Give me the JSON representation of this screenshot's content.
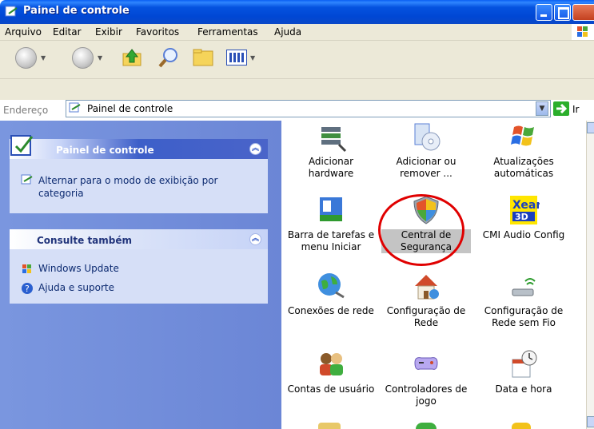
{
  "window": {
    "title": "Painel de controle",
    "icon": "control-panel-icon"
  },
  "menu": [
    "Arquivo",
    "Editar",
    "Exibir",
    "Favoritos",
    "Ferramentas",
    "Ajuda"
  ],
  "toolbar": {
    "back_icon": "back-arrow-icon",
    "forward_icon": "forward-arrow-icon",
    "up_icon": "folder-up-icon",
    "search_icon": "search-icon",
    "folders_icon": "folders-icon",
    "views_icon": "views-icon"
  },
  "address": {
    "label": "Endereço",
    "value": "Painel de controle",
    "go_label": "Ir"
  },
  "left": {
    "panel1": {
      "title": "Painel de controle",
      "link": "Alternar para o modo de exibição por categoria"
    },
    "panel2": {
      "title": "Consulte também",
      "links": [
        "Windows Update",
        "Ajuda e suporte"
      ]
    }
  },
  "items": [
    {
      "label": "Adicionar hardware",
      "icon": "add-hardware-icon"
    },
    {
      "label": "Adicionar ou remover ...",
      "icon": "add-remove-programs-icon"
    },
    {
      "label": "Atualizações automáticas",
      "icon": "automatic-updates-icon"
    },
    {
      "label": "Barra de tarefas e menu Iniciar",
      "icon": "taskbar-start-menu-icon"
    },
    {
      "label": "Central de Segurança",
      "icon": "security-center-icon",
      "selected": true
    },
    {
      "label": "CMI Audio Config",
      "icon": "cmi-audio-icon"
    },
    {
      "label": "Conexões de rede",
      "icon": "network-connections-icon"
    },
    {
      "label": "Configuração de Rede",
      "icon": "network-setup-icon"
    },
    {
      "label": "Configuração de Rede sem Fio",
      "icon": "wireless-network-setup-icon"
    },
    {
      "label": "Contas de usuário",
      "icon": "user-accounts-icon"
    },
    {
      "label": "Controladores de jogo",
      "icon": "game-controllers-icon"
    },
    {
      "label": "Data e hora",
      "icon": "date-time-icon"
    }
  ],
  "colors": {
    "title_bar": "#0047d4",
    "left_pane": "#6b86d6",
    "highlight_circle": "#e00000"
  }
}
